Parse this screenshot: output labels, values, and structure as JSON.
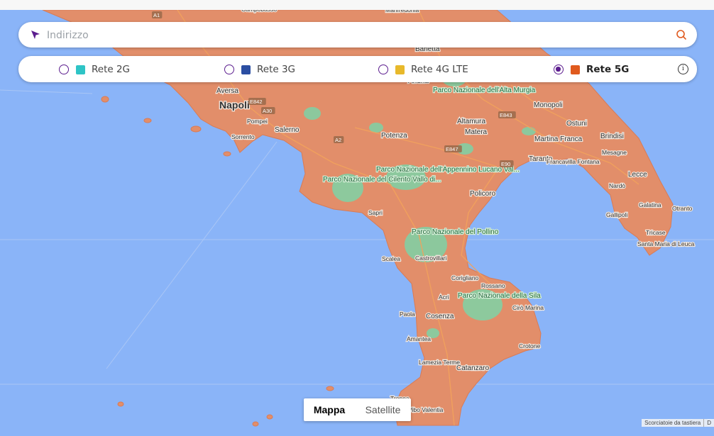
{
  "search": {
    "placeholder": "Indirizzo",
    "nav_icon": "navigation-arrow-icon",
    "search_icon": "search-icon"
  },
  "filters": {
    "options": [
      {
        "label": "Rete 2G",
        "color": "#2ec4c6",
        "selected": false
      },
      {
        "label": "Rete 3G",
        "color": "#2b4ea2",
        "selected": false
      },
      {
        "label": "Rete 4G LTE",
        "color": "#e8b92b",
        "selected": false
      },
      {
        "label": "Rete 5G",
        "color": "#e05a1e",
        "selected": true
      }
    ],
    "info_icon": "info-icon"
  },
  "map_type": {
    "map_label": "Mappa",
    "satellite_label": "Satellite",
    "active": "Mappa"
  },
  "attribution": {
    "shortcuts": "Scorciatoie da tastiera",
    "data": "D"
  },
  "map": {
    "sea_color": "#8ab4f8",
    "coverage_color": "#e28e6a",
    "park_color": "#7ed3a6",
    "labels": {
      "manfredonia": "Manfredonia",
      "campobasso": "Campobasso",
      "barletta": "Barletta",
      "andria": "Andria",
      "parco_murgia": "Parco Nazionale dell'Alta Murgia",
      "aversa": "Aversa",
      "napoli": "Napoli",
      "pompei": "Pompei",
      "sorrento": "Sorrento",
      "salerno": "Salerno",
      "monopoli": "Monopoli",
      "altamura": "Altamura",
      "matera": "Matera",
      "ostuni": "Ostuni",
      "brindisi": "Brindisi",
      "martina_franca": "Martina Franca",
      "mesagne": "Mesagne",
      "potenza": "Potenza",
      "taranto": "Taranto",
      "francavilla": "Francavilla Fontana",
      "lecce": "Lecce",
      "parco_appennino": "Parco Nazionale dell'Appennino Lucano Val...",
      "parco_cilento": "Parco Nazionale del Cilento Vallo di...",
      "policoro": "Policoro",
      "nardo": "Nardò",
      "galatina": "Galatina",
      "otranto": "Otranto",
      "gallipoli": "Gallipoli",
      "sapri": "Sapri",
      "tricase": "Tricase",
      "santa_maria": "Santa Maria di Leuca",
      "parco_pollino": "Parco Nazionale del Pollino",
      "scalea": "Scalea",
      "castrovillari": "Castrovillari",
      "corigliano": "Corigliano",
      "rossano": "Rossano",
      "acri": "Acri",
      "parco_sila": "Parco Nazionale della Sila",
      "ciro_marina": "Cirò Marina",
      "paola": "Paola",
      "cosenza": "Cosenza",
      "crotone": "Crotone",
      "amantea": "Amantea",
      "lamezia": "Lamezia Terme",
      "catanzaro": "Catanzaro",
      "vibo": "Vibo Valentia",
      "tropea": "Tropea"
    },
    "road_labels": [
      "A1",
      "E842",
      "A30",
      "E843",
      "E847",
      "E90",
      "A2"
    ]
  }
}
